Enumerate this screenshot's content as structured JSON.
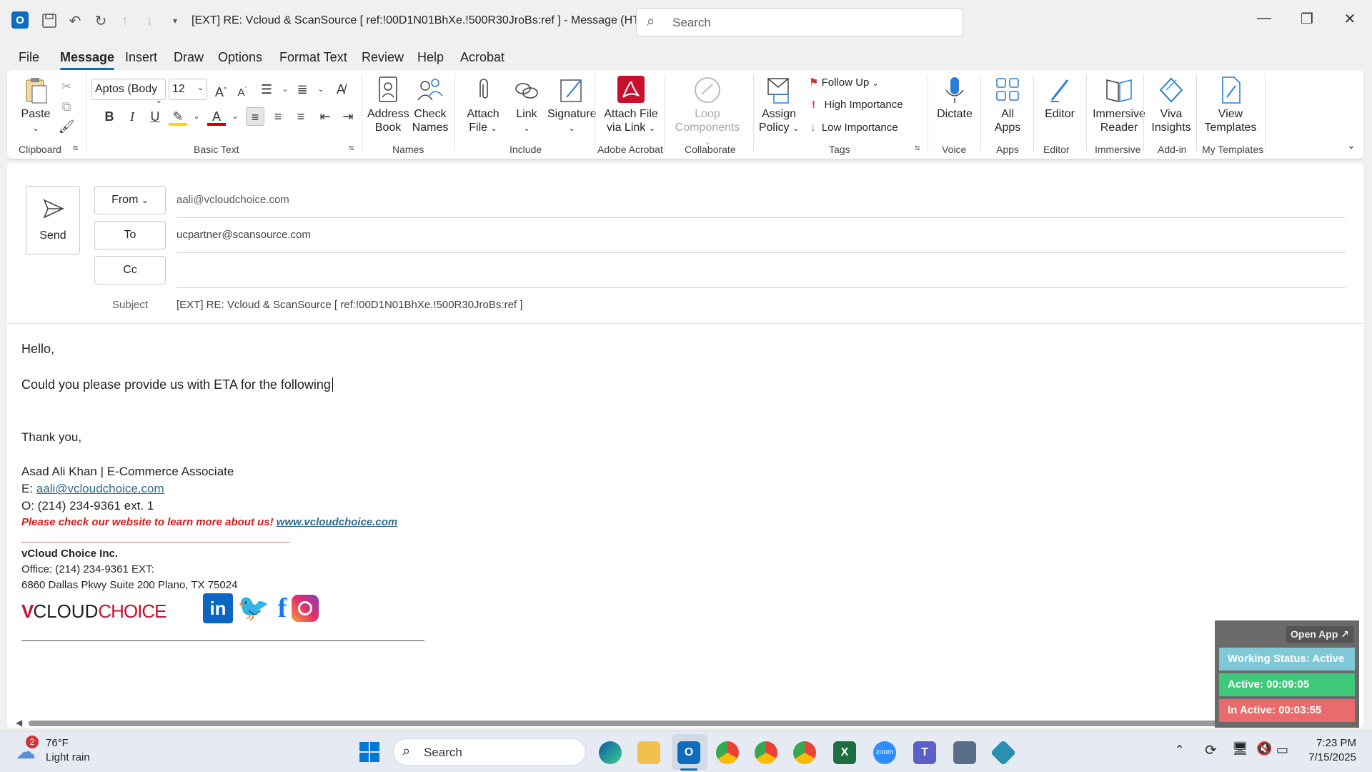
{
  "titlebar": {
    "title": "[EXT] RE: Vcloud & ScanSource    [ ref:!00D1N01BhXe.!500R30JroBs:ref ]  -  Message (HT...",
    "search_placeholder": "Search"
  },
  "menu": [
    "File",
    "Message",
    "Insert",
    "Draw",
    "Options",
    "Format Text",
    "Review",
    "Help",
    "Acrobat"
  ],
  "ribbon": {
    "clipboard": {
      "paste": "Paste",
      "group": "Clipboard"
    },
    "basic_text": {
      "font": "Aptos (Body",
      "size": "12",
      "group": "Basic Text"
    },
    "names": {
      "address_book": [
        "Address",
        "Book"
      ],
      "check_names": [
        "Check",
        "Names"
      ],
      "group": "Names"
    },
    "include": {
      "attach_file": [
        "Attach",
        "File"
      ],
      "link": "Link",
      "signature": "Signature",
      "group": "Include"
    },
    "acrobat": {
      "attach_via_link": [
        "Attach File",
        "via Link"
      ],
      "group": "Adobe Acrobat"
    },
    "collaborate": {
      "loop": [
        "Loop",
        "Components"
      ],
      "group": "Collaborate"
    },
    "tags": {
      "assign_policy": [
        "Assign",
        "Policy"
      ],
      "follow_up": "Follow Up",
      "high": "High Importance",
      "low": "Low Importance",
      "group": "Tags"
    },
    "voice": {
      "dictate": "Dictate",
      "group": "Voice"
    },
    "apps": {
      "all_apps": [
        "All",
        "Apps"
      ],
      "group": "Apps"
    },
    "editor": {
      "editor": "Editor",
      "group": "Editor"
    },
    "immersive": {
      "reader": [
        "Immersive",
        "Reader"
      ],
      "group": "Immersive"
    },
    "addin": {
      "viva": [
        "Viva",
        "Insights"
      ],
      "group": "Add-in"
    },
    "templates": {
      "view": [
        "View",
        "Templates"
      ],
      "group": "My Templates"
    }
  },
  "compose": {
    "send": "Send",
    "from_label": "From",
    "from_value": "aali@vcloudchoice.com",
    "to_label": "To",
    "to_value": "ucpartner@scansource.com",
    "cc_label": "Cc",
    "subject_label": "Subject",
    "subject_value": "[EXT] RE: Vcloud & ScanSource    [ ref:!00D1N01BhXe.!500R30JroBs:ref ]"
  },
  "body": {
    "greeting": "Hello,",
    "line1": "Could you please provide us with ETA for the following",
    "closing": "Thank you,",
    "sig_name": "Asad Ali Khan  | E-Commerce Associate",
    "sig_email_prefix": "E: ",
    "sig_email": "aali@vcloudchoice.com",
    "sig_phone": "O: (214) 234-9361 ext. 1",
    "promo_text": "Please check our website to learn more about us! ",
    "promo_link": "www.vcloudchoice.com",
    "company": "vCloud Choice Inc.",
    "office": "Office: (214) 234-9361 EXT:",
    "address": "6860 Dallas Pkwy Suite 200 Plano, TX 75024",
    "logo_text": "VCLOUDCHOICE"
  },
  "widget": {
    "open_app": "Open App ↗",
    "status": "Working Status: Active",
    "active": "Active: 00:09:05",
    "inactive": "In Active: 00:03:55"
  },
  "taskbar": {
    "weather_temp": "76°F",
    "weather_desc": "Light rain",
    "weather_badge": "2",
    "search": "Search",
    "time": "7:23 PM",
    "date": "7/15/2025"
  }
}
